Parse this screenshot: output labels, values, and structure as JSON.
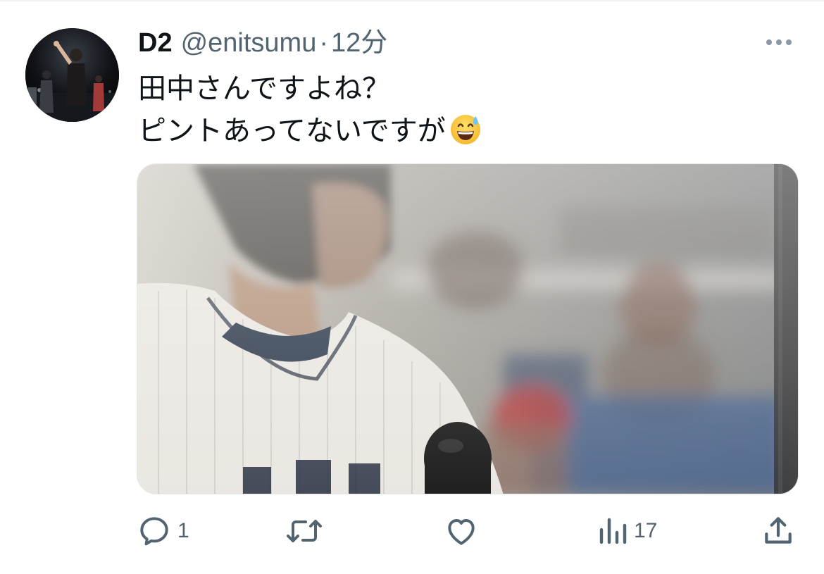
{
  "tweet": {
    "author": {
      "display_name": "D2",
      "handle": "@enitsumu",
      "separator": "·",
      "time": "12分"
    },
    "text_lines": [
      "田中さんですよね？",
      "ピントあってないですが"
    ],
    "emoji": "grinning-face-with-sweat-icon",
    "media": {
      "description_icon": "photo"
    },
    "actions": {
      "reply": {
        "icon": "reply-icon",
        "count": "1"
      },
      "retweet": {
        "icon": "retweet-icon",
        "count": ""
      },
      "like": {
        "icon": "heart-icon",
        "count": ""
      },
      "views": {
        "icon": "views-icon",
        "count": "17"
      },
      "share": {
        "icon": "share-icon",
        "count": ""
      }
    }
  },
  "colors": {
    "text_primary": "#0f1419",
    "text_secondary": "#536471",
    "divider": "#eff3f4"
  }
}
